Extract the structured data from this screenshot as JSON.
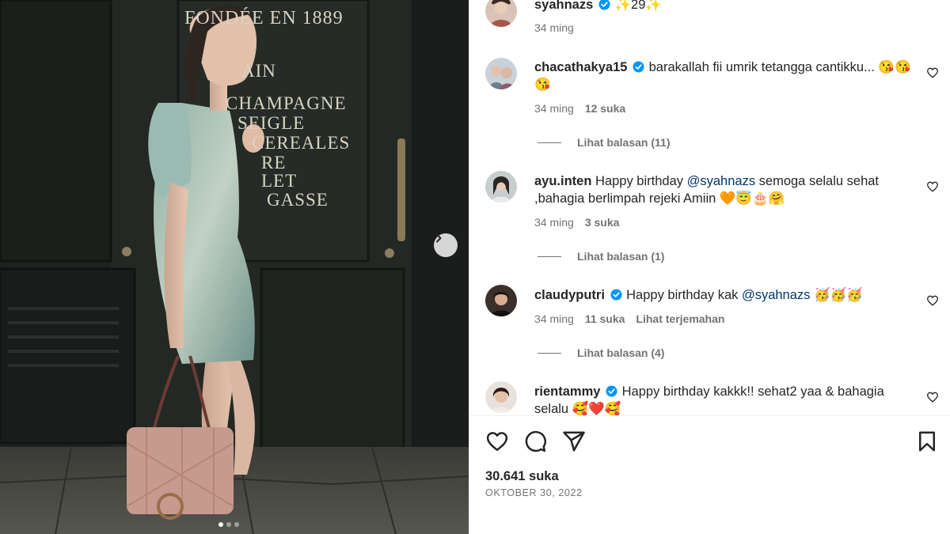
{
  "photo": {
    "sign_lines": [
      "FONDÉE EN 1889",
      "AIN",
      "CHAMPAGNE",
      "SEIGLE",
      "CEREALES",
      "RE",
      "LET",
      "GASSE"
    ],
    "next_icon": "chevron-right-icon",
    "carousel": {
      "count": 3,
      "active": 1
    }
  },
  "caption": {
    "username": "syahnazs",
    "text": "✨29✨",
    "time": "34 ming"
  },
  "comments": [
    {
      "username": "chacathakya15",
      "verified": true,
      "text": "barakallah fii umrik tetangga cantikku... 😘😘😘",
      "time": "34 ming",
      "likes": "12 suka",
      "replies": "Lihat balasan (11)"
    },
    {
      "username": "ayu.inten",
      "verified": false,
      "text_before": "Happy birthday ",
      "mention": "@syahnazs",
      "text_after": " semoga selalu sehat ,bahagia berlimpah rejeki Amiin 🧡😇🎂🤗",
      "time": "34 ming",
      "likes": "3 suka",
      "replies": "Lihat balasan (1)"
    },
    {
      "username": "claudyputri",
      "verified": true,
      "text_before": "Happy birthday kak ",
      "mention": "@syahnazs",
      "text_after": " 🥳🥳🥳",
      "time": "34 ming",
      "likes": "11 suka",
      "translate": "Lihat terjemahan",
      "replies": "Lihat balasan (4)"
    },
    {
      "username": "rientammy",
      "verified": true,
      "text": "Happy birthday kakkk!! sehat2 yaa & bahagia selalu 🥰❤️🥰"
    }
  ],
  "actions": {
    "like_icon": "heart-icon",
    "comment_icon": "comment-icon",
    "share_icon": "send-icon",
    "save_icon": "bookmark-icon"
  },
  "likes_count": "30.641 suka",
  "post_date": "OKTOBER 30, 2022",
  "colors": {
    "verified": "#0095f6",
    "mention": "#00376b",
    "secondary_text": "#737373"
  }
}
